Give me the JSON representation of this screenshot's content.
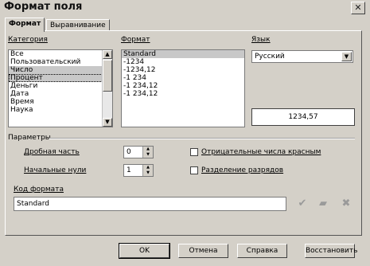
{
  "window": {
    "title": "Формат поля",
    "close_glyph": "✕"
  },
  "tabs": [
    {
      "label": "Формат",
      "active": true
    },
    {
      "label": "Выравнивание",
      "active": false
    }
  ],
  "category": {
    "label": "Категория",
    "items": [
      "Все",
      "Пользовательский",
      "Число",
      "Процент",
      "Деньги",
      "Дата",
      "Время",
      "Наука"
    ],
    "selected": "Число"
  },
  "format": {
    "label": "Формат",
    "items": [
      "Standard",
      "-1234",
      "-1234,12",
      "-1 234",
      "-1 234,12",
      "-1 234,12"
    ],
    "selected": "Standard"
  },
  "language": {
    "label": "Язык",
    "value": "Русский"
  },
  "preview": {
    "value": "1234,57"
  },
  "options": {
    "label": "Параметры",
    "decimal_places": {
      "label": "Дробная часть",
      "value": "0"
    },
    "leading_zeros": {
      "label": "Начальные нули",
      "value": "1"
    },
    "negative_red": {
      "label": "Отрицательные числа красным",
      "checked": false
    },
    "thousands_sep": {
      "label": "Разделение разрядов",
      "checked": false
    }
  },
  "format_code": {
    "label": "Код формата",
    "value": "Standard"
  },
  "icons": {
    "accept": "check-icon",
    "edit": "note-icon",
    "delete": "delete-icon"
  },
  "buttons": {
    "ok": "OK",
    "cancel": "Отмена",
    "help": "Справка",
    "reset": "Восстановить"
  }
}
